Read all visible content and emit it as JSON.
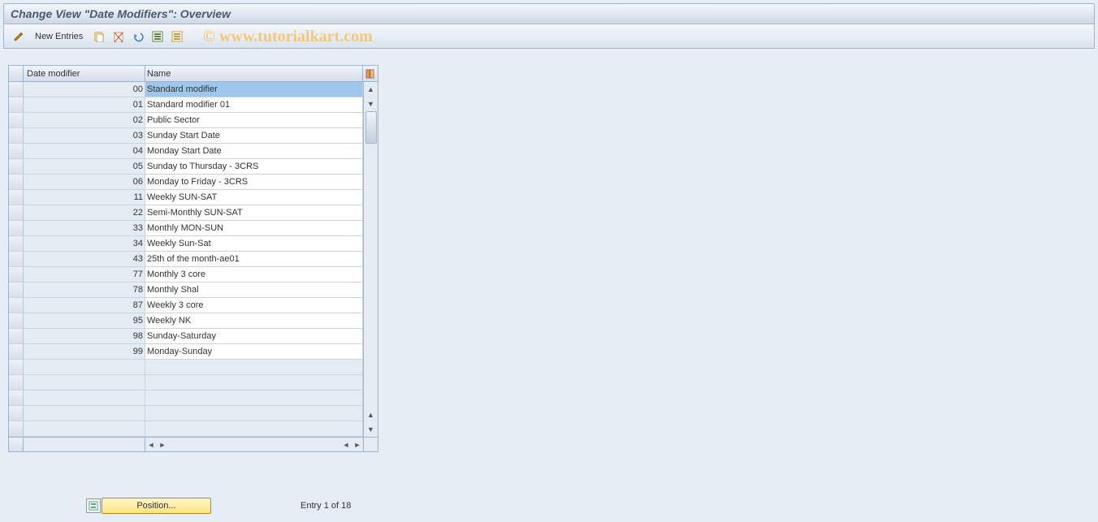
{
  "title": "Change View \"Date Modifiers\": Overview",
  "toolbar": {
    "new_entries_label": "New Entries"
  },
  "watermark": "© www.tutorialkart.com",
  "grid": {
    "headers": {
      "code": "Date modifier",
      "name": "Name"
    },
    "rows": [
      {
        "code": "00",
        "name": "Standard modifier",
        "selected": true
      },
      {
        "code": "01",
        "name": "Standard modifier 01"
      },
      {
        "code": "02",
        "name": "Public Sector"
      },
      {
        "code": "03",
        "name": "Sunday Start Date"
      },
      {
        "code": "04",
        "name": "Monday Start Date"
      },
      {
        "code": "05",
        "name": "Sunday to Thursday - 3CRS"
      },
      {
        "code": "06",
        "name": "Monday to Friday - 3CRS"
      },
      {
        "code": "11",
        "name": "Weekly SUN-SAT"
      },
      {
        "code": "22",
        "name": "Semi-Monthly SUN-SAT"
      },
      {
        "code": "33",
        "name": "Monthly MON-SUN"
      },
      {
        "code": "34",
        "name": "Weekly Sun-Sat"
      },
      {
        "code": "43",
        "name": "25th of the month-ae01"
      },
      {
        "code": "77",
        "name": "Monthly 3 core"
      },
      {
        "code": "78",
        "name": "Monthly Shal"
      },
      {
        "code": "87",
        "name": "Weekly 3 core"
      },
      {
        "code": "95",
        "name": "Weekly NK"
      },
      {
        "code": "98",
        "name": "Sunday-Saturday"
      },
      {
        "code": "99",
        "name": "Monday-Sunday"
      }
    ],
    "empty_rows": 5
  },
  "footer": {
    "position_label": "Position...",
    "entry_count": "Entry 1 of 18"
  }
}
